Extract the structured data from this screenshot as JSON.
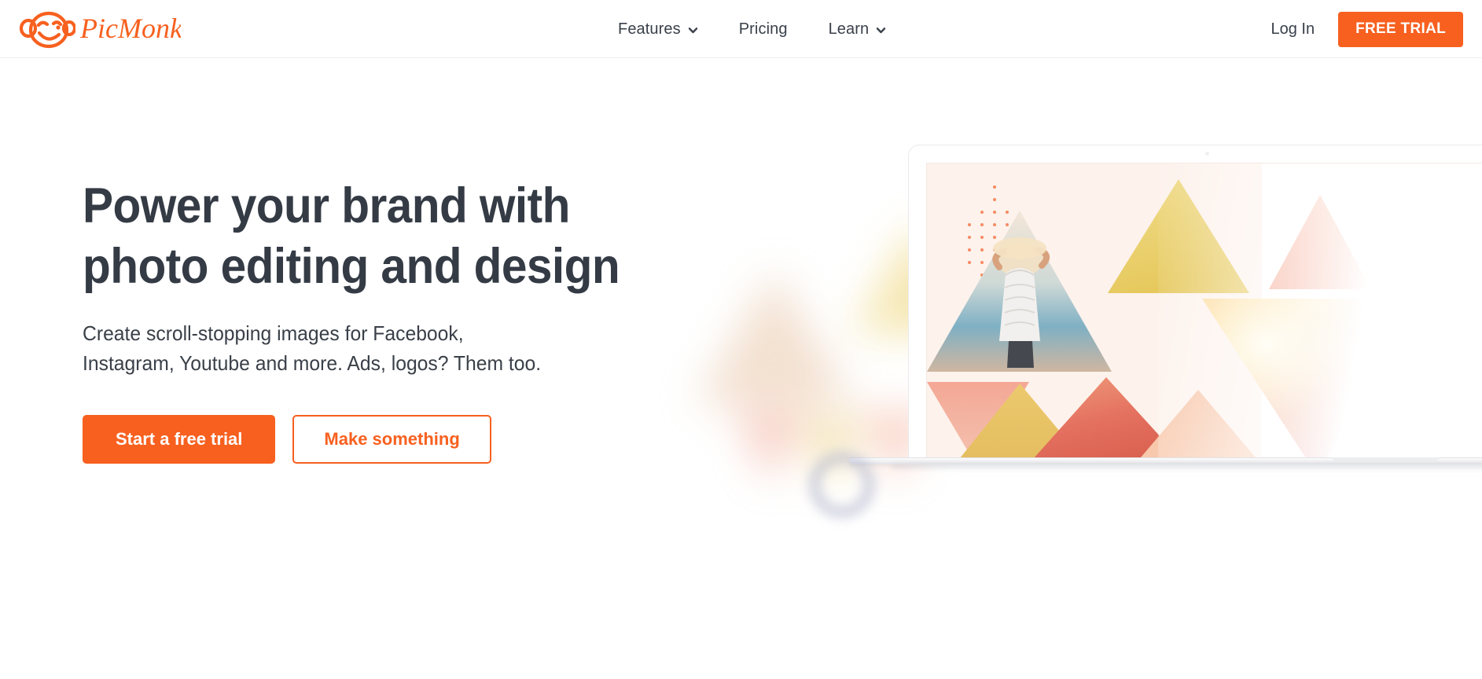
{
  "brand": {
    "name": "PicMonkey",
    "logo_icon": "monkey-face-icon",
    "color": "#f7601f"
  },
  "nav": {
    "items": [
      {
        "label": "Features",
        "has_dropdown": true,
        "icon": "chevron-down-icon"
      },
      {
        "label": "Pricing",
        "has_dropdown": false,
        "icon": ""
      },
      {
        "label": "Learn",
        "has_dropdown": true,
        "icon": "chevron-down-icon"
      }
    ],
    "login_label": "Log In",
    "trial_label": "FREE TRIAL"
  },
  "hero": {
    "headline_line1": "Power your brand with",
    "headline_line2": "photo editing and design",
    "subhead_line1": "Create scroll-stopping images for Facebook,",
    "subhead_line2": "Instagram, Youtube and more. Ads, logos? Them too.",
    "primary_cta": "Start a free trial",
    "secondary_cta": "Make something"
  },
  "visual": {
    "device": "laptop-mockup",
    "artwork": "triangle-photo-collage",
    "screen_bg": "#fdf2ec",
    "dot_pattern_color": "#f58b63",
    "triangles": [
      {
        "name": "yellow-up",
        "color": "#ecd06a"
      },
      {
        "name": "salmon-up-small",
        "color": "#f6a287"
      },
      {
        "name": "beach-photo-up",
        "color": "#d8c0a8"
      },
      {
        "name": "palm-sun-down",
        "color": "#eb8e84"
      },
      {
        "name": "coral-down",
        "color": "#f2a28f"
      },
      {
        "name": "gold-up",
        "color": "#e8c96e"
      },
      {
        "name": "palm-red-up",
        "color": "#e8836d"
      },
      {
        "name": "peach-up",
        "color": "#f6b897"
      }
    ]
  },
  "colors": {
    "accent": "#f7601f",
    "text_dark": "#343b45",
    "text_nav": "#39404a",
    "border": "#eceef0"
  }
}
